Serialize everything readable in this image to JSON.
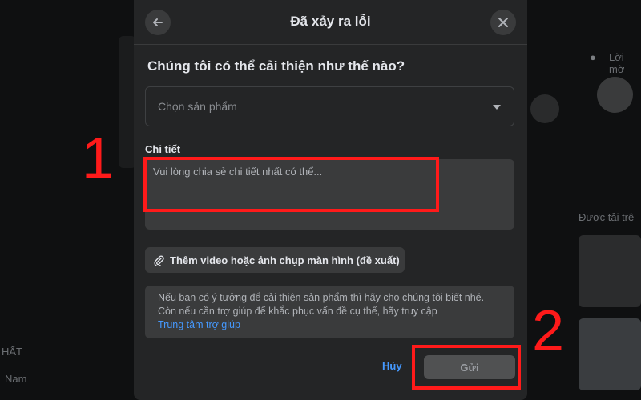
{
  "background": {
    "left_text_1": "HẤT",
    "left_text_2": "Nam",
    "right_text_1": "Lời mờ",
    "right_text_2": "Được tải trê"
  },
  "modal": {
    "title": "Đã xảy ra lỗi",
    "question": "Chúng tôi có thể cải thiện như thế nào?",
    "product_select": {
      "placeholder": "Chọn sản phẩm"
    },
    "details_label": "Chi tiết",
    "details_textarea": {
      "placeholder": "Vui lòng chia sẻ chi tiết nhất có thể..."
    },
    "attach_button": "Thêm video hoặc ảnh chụp màn hình (đề xuất)",
    "info_text": "Nếu bạn có ý tưởng để cải thiện sản phẩm thì hãy cho chúng tôi biết nhé. Còn nếu cần trợ giúp để khắc phục vấn đề cụ thể, hãy truy cập",
    "info_link": "Trung tâm trợ giúp",
    "cancel_button": "Hủy",
    "send_button": "Gửi"
  },
  "annotations": {
    "step_1": "1",
    "step_2": "2"
  },
  "colors": {
    "modal_bg": "#242526",
    "field_bg": "#3a3b3c",
    "link_blue": "#4599ff",
    "annotation_red": "#ff1a1a"
  }
}
